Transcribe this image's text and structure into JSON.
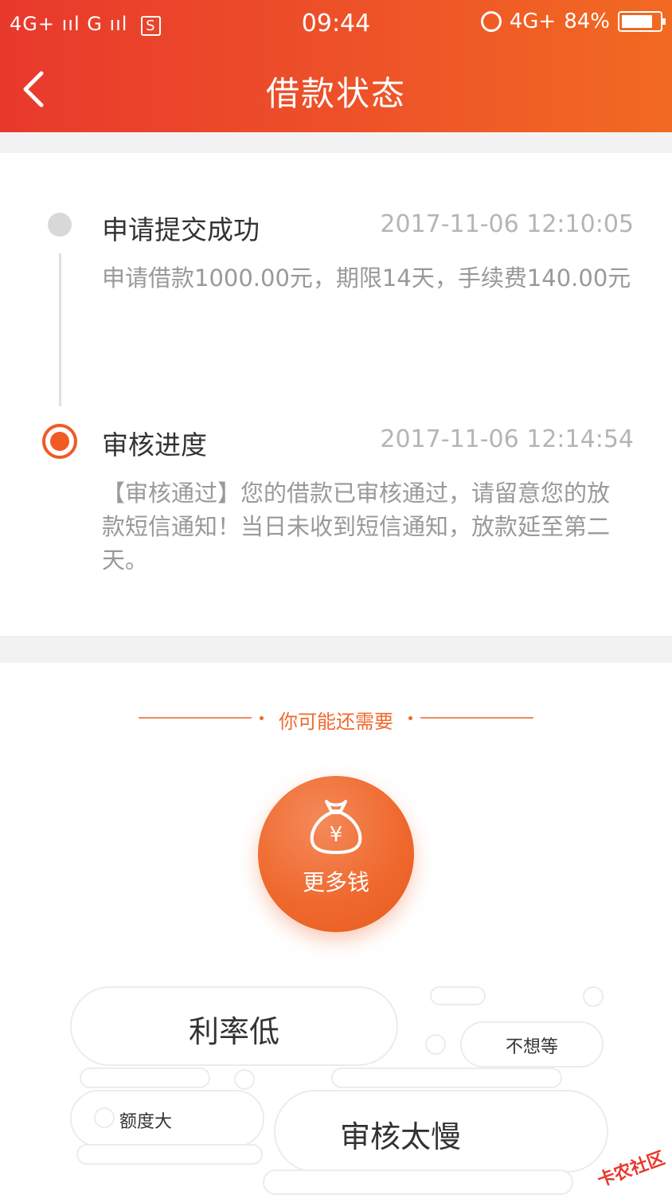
{
  "status_bar": {
    "signal": "4G+ ııl G ııl",
    "sim_icon": "S",
    "time": "09:44",
    "network": "4G+",
    "battery": "84%",
    "battery_level": 0.84
  },
  "header": {
    "title": "借款状态",
    "back_icon": "chevron-left-icon"
  },
  "timeline": [
    {
      "title": "申请提交成功",
      "time": "2017-11-06 12:10:05",
      "desc": "申请借款1000.00元，期限14天，手续费140.00元",
      "state": "done"
    },
    {
      "title": "审核进度",
      "time": "2017-11-06 12:14:54",
      "desc": "【审核通过】您的借款已审核通过，请留意您的放款短信通知！当日未收到短信通知，放款延至第二天。",
      "state": "active"
    }
  ],
  "recommend": {
    "heading": "你可能还需要",
    "main_button": "更多钱",
    "tags": [
      "利率低",
      "不想等",
      "额度大",
      "审核太慢"
    ]
  },
  "watermark": "卡农社区",
  "colors": {
    "accent": "#ef5b23",
    "header_start": "#e8392c",
    "header_end": "#f26a21"
  }
}
